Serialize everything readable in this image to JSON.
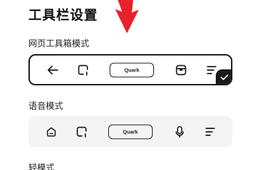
{
  "page": {
    "title": "工具栏设置"
  },
  "sections": {
    "web_toolbox": {
      "label": "网页工具箱模式",
      "selected": true,
      "icons": [
        "back-arrow-icon",
        "multi-window-icon",
        "quark-logo",
        "toolbox-icon",
        "menu-icon"
      ],
      "center_label": "Quark"
    },
    "voice": {
      "label": "语音模式",
      "selected": false,
      "icons": [
        "home-icon",
        "multi-window-icon",
        "quark-logo",
        "microphone-icon",
        "menu-icon"
      ],
      "center_label": "Quark"
    },
    "light": {
      "label": "轻模式"
    }
  },
  "colors": {
    "accent": "#1a1a1a",
    "annotation_arrow": "#e8212b",
    "unselected_bg": "#f4f4f5"
  }
}
